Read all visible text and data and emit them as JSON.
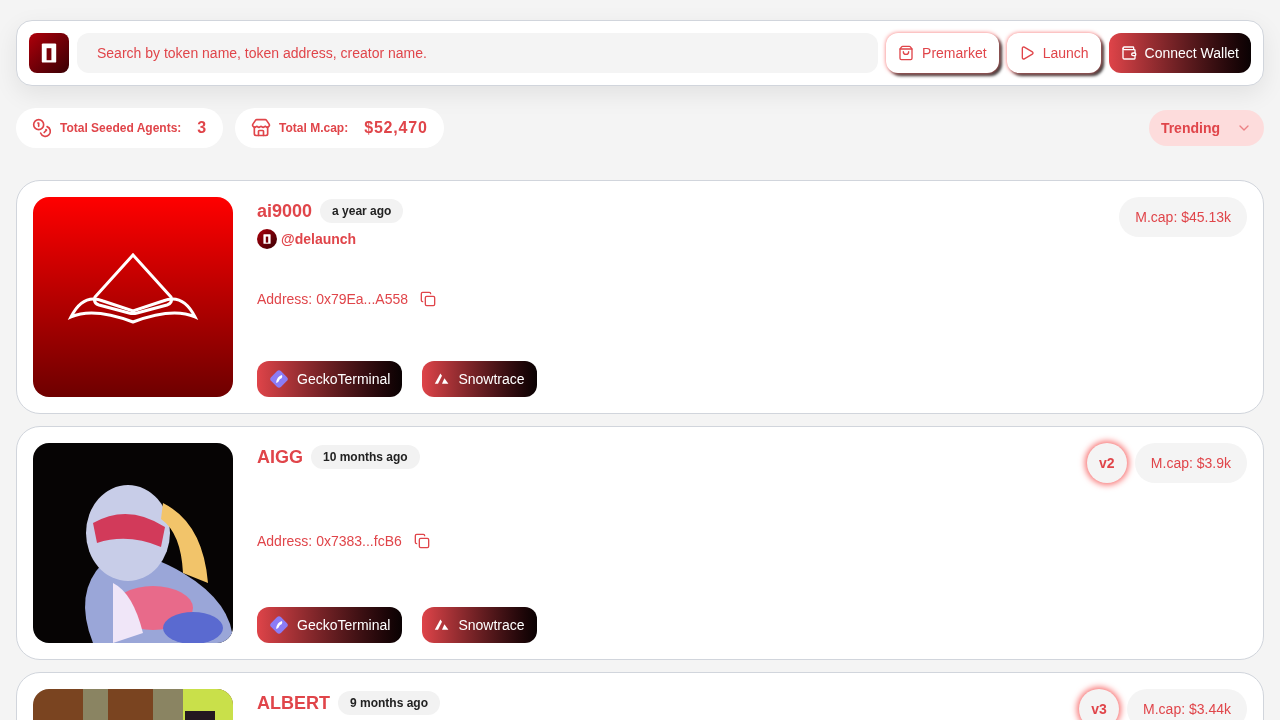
{
  "header": {
    "search": {
      "placeholder": "Search by token name, token address, creator name."
    },
    "buttons": [
      {
        "label": "Premarket",
        "kind": "outline"
      },
      {
        "label": "Launch",
        "kind": "outline"
      },
      {
        "label": "Connect Wallet",
        "kind": "gradient"
      }
    ]
  },
  "stats": [
    {
      "label": "Total Seeded Agents:",
      "value": "3"
    },
    {
      "label": "Total M.cap:",
      "value": "$52,470"
    }
  ],
  "sort": {
    "label": "Trending"
  },
  "tokens": [
    {
      "name": "ai9000",
      "age": "a year ago",
      "creator": "@delaunch",
      "address": "Address: 0x79Ea...A558",
      "mcap": "M.cap: $45.13k",
      "links": [
        {
          "label": "GeckoTerminal",
          "kind": "gecko"
        },
        {
          "label": "Snowtrace",
          "kind": "snowtrace"
        }
      ]
    },
    {
      "name": "AIGG",
      "age": "10 months ago",
      "version": "v2",
      "address": "Address: 0x7383...fcB6",
      "mcap": "M.cap: $3.9k",
      "links": [
        {
          "label": "GeckoTerminal",
          "kind": "gecko"
        },
        {
          "label": "Snowtrace",
          "kind": "snowtrace"
        }
      ]
    },
    {
      "name": "ALBERT",
      "age": "9 months ago",
      "version": "v3",
      "mcap": "M.cap: $3.44k"
    }
  ]
}
